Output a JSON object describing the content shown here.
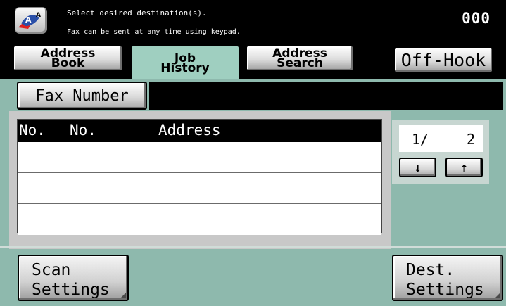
{
  "header": {
    "message_line1": "Select desired destination(s).",
    "message_line2": "Fax can be sent at any time using keypad.",
    "counter": "000",
    "icon": "accessibility-icon"
  },
  "tabs": [
    {
      "line1": "Address",
      "line2": "Book",
      "active": false
    },
    {
      "line1": "Job",
      "line2": "History",
      "active": true
    },
    {
      "line1": "Address",
      "line2": "Search",
      "active": false
    }
  ],
  "offhook_label": "Off-Hook",
  "fax_number": {
    "label": "Fax Number",
    "value": ""
  },
  "table": {
    "columns": [
      "No.",
      "No.",
      "Address"
    ],
    "rows": [
      {},
      {},
      {}
    ]
  },
  "pager": {
    "current": "1/",
    "total": "2",
    "down_icon": "arrow-down-icon",
    "up_icon": "arrow-up-icon"
  },
  "bottom": {
    "scan_line1": "Scan",
    "scan_line2": "Settings",
    "dest_line1": "Dest.",
    "dest_line2": "Settings"
  },
  "colors": {
    "panel": "#8eb9ad",
    "active_tab": "#9fcfc0",
    "header_bg": "#000000"
  }
}
